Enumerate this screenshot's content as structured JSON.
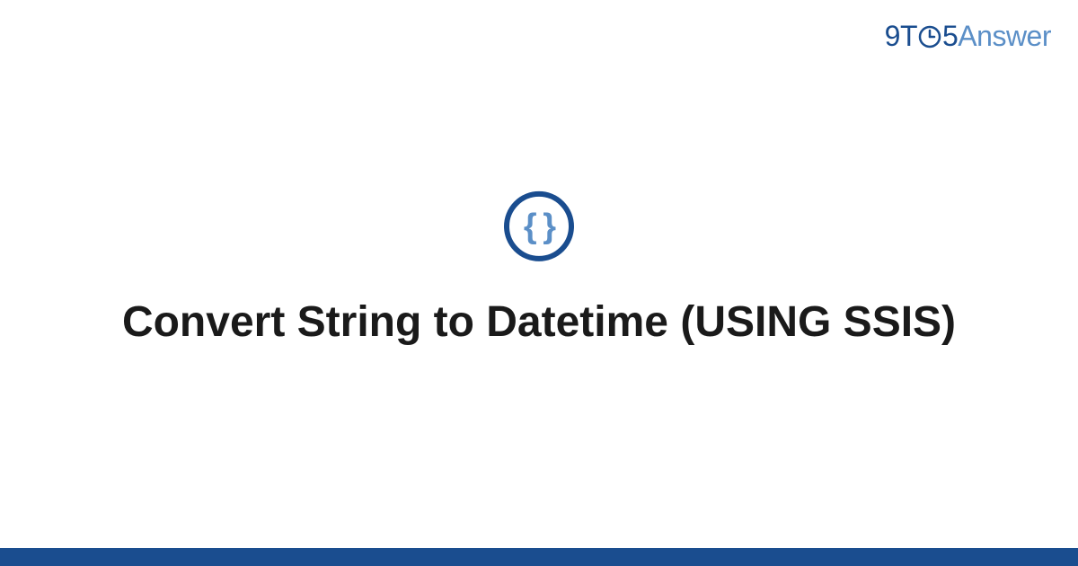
{
  "logo": {
    "part1": "9T",
    "part2": "5",
    "part3": "Answer"
  },
  "icon": {
    "name": "code-braces",
    "glyph": "{ }"
  },
  "title": "Convert String to Datetime (USING SSIS)",
  "colors": {
    "primary": "#1a4d8f",
    "secondary": "#5b8fc7"
  }
}
